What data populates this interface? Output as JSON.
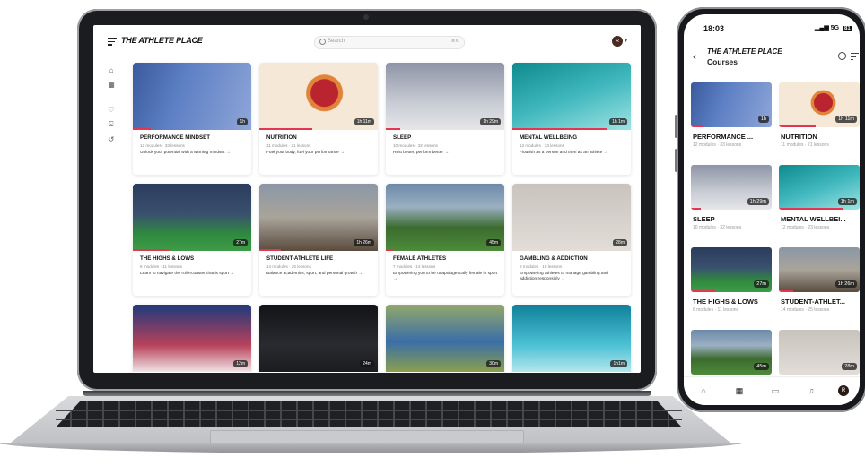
{
  "laptop": {
    "logo": "THE ATHLETE PLACE",
    "search_placeholder": "Search",
    "search_shortcut": "⌘K",
    "avatar_initial": "R",
    "courses": [
      {
        "title": "PERFORMANCE MINDSET",
        "meta": "12 modules · 33 lessons",
        "desc": "Unlock your potential with a winning mindset →",
        "duration": "1h",
        "progress": 0.15
      },
      {
        "title": "NUTRITION",
        "meta": "11 modules · 21 lessons",
        "desc": "Fuel your body, fuel your performance →",
        "duration": "1h 11m",
        "progress": 0.45
      },
      {
        "title": "SLEEP",
        "meta": "10 modules · 32 lessons",
        "desc": "Rest better, perform better →",
        "duration": "1h 29m",
        "progress": 0.12
      },
      {
        "title": "MENTAL WELLBEING",
        "meta": "12 modules · 23 lessons",
        "desc": "Flourish as a person and then as an athlete →",
        "duration": "1h 1m",
        "progress": 0.8
      },
      {
        "title": "THE HIGHS & LOWS",
        "meta": "6 modules · 11 lessons",
        "desc": "Learn to navigate the rollercoaster that is sport →",
        "duration": "27m",
        "progress": 0.3
      },
      {
        "title": "STUDENT-ATHLETE LIFE",
        "meta": "14 modules · 25 lessons",
        "desc": "Balance academics, sport, and personal growth →",
        "duration": "1h 26m",
        "progress": 0.18
      },
      {
        "title": "FEMALE ATHLETES",
        "meta": "7 modules · 14 lessons",
        "desc": "Empowering you to be unapologetically female in sport →",
        "duration": "45m",
        "progress": 0.06
      },
      {
        "title": "GAMBLING & ADDICTION",
        "meta": "8 modules · 15 lessons",
        "desc": "Empowering athletes to manage gambling and addiction responsibly →",
        "duration": "28m",
        "progress": 0.0
      },
      {
        "title": "",
        "meta": "",
        "desc": "",
        "duration": "12m",
        "progress": 0.0
      },
      {
        "title": "",
        "meta": "",
        "desc": "",
        "duration": "24m",
        "progress": 0.0
      },
      {
        "title": "",
        "meta": "",
        "desc": "",
        "duration": "30m",
        "progress": 0.0
      },
      {
        "title": "",
        "meta": "",
        "desc": "",
        "duration": "1h1m",
        "progress": 0.0
      }
    ]
  },
  "phone": {
    "time": "18:03",
    "network": "5G",
    "battery": "81",
    "logo": "THE ATHLETE PLACE",
    "page_title": "Courses",
    "courses": [
      {
        "title": "PERFORMANCE ...",
        "meta": "12 modules · 33 lessons",
        "duration": "1h",
        "progress": 0.15
      },
      {
        "title": "NUTRITION",
        "meta": "11 modules · 21 lessons",
        "duration": "1h 11m",
        "progress": 0.45
      },
      {
        "title": "SLEEP",
        "meta": "10 modules · 32 lessons",
        "duration": "1h 29m",
        "progress": 0.12
      },
      {
        "title": "MENTAL WELLBEI...",
        "meta": "12 modules · 23 lessons",
        "duration": "1h 1m",
        "progress": 0.8
      },
      {
        "title": "THE HIGHS & LOWS",
        "meta": "6 modules · 11 lessons",
        "duration": "27m",
        "progress": 0.3
      },
      {
        "title": "STUDENT-ATHLET...",
        "meta": "14 modules · 25 lessons",
        "duration": "1h 26m",
        "progress": 0.18
      },
      {
        "title": "",
        "meta": "",
        "duration": "45m",
        "progress": 0.0
      },
      {
        "title": "",
        "meta": "",
        "duration": "28m",
        "progress": 0.0
      }
    ],
    "avatar_initial": "R"
  },
  "colors": {
    "accent": "#e33650",
    "text": "#111111"
  },
  "icons": [
    "menu-icon",
    "search-icon",
    "home-icon",
    "grid-icon",
    "heart-icon",
    "lock-icon",
    "history-icon",
    "chat-icon",
    "bell-icon",
    "filter-icon",
    "back-icon"
  ]
}
